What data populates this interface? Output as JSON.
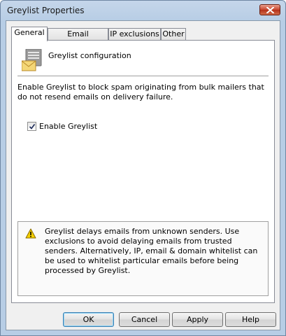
{
  "window": {
    "title": "Greylist Properties",
    "close_icon": "close-icon"
  },
  "tabs": [
    {
      "label": "General",
      "active": true
    },
    {
      "label": "Email exclusions",
      "active": false
    },
    {
      "label": "IP exclusions",
      "active": false
    },
    {
      "label": "Other",
      "active": false
    }
  ],
  "general": {
    "header_icon": "email-config-icon",
    "header_label": "Greylist configuration",
    "description": "Enable Greylist to block spam originating from bulk mailers that do not resend emails on delivery failure.",
    "enable_checkbox": {
      "label": "Enable Greylist",
      "checked": true
    },
    "notice": {
      "icon": "warning-icon",
      "text": "Greylist delays emails from unknown senders. Use exclusions to avoid delaying emails from trusted senders. Alternatively, IP, email & domain whitelist can be used to whitelist particular emails before being processed by Greylist."
    }
  },
  "buttons": {
    "ok": "OK",
    "cancel": "Cancel",
    "apply": "Apply",
    "help": "Help"
  },
  "colors": {
    "frame": "#b7cde5",
    "close_button": "#c9452c",
    "warning": "#f5d000"
  }
}
